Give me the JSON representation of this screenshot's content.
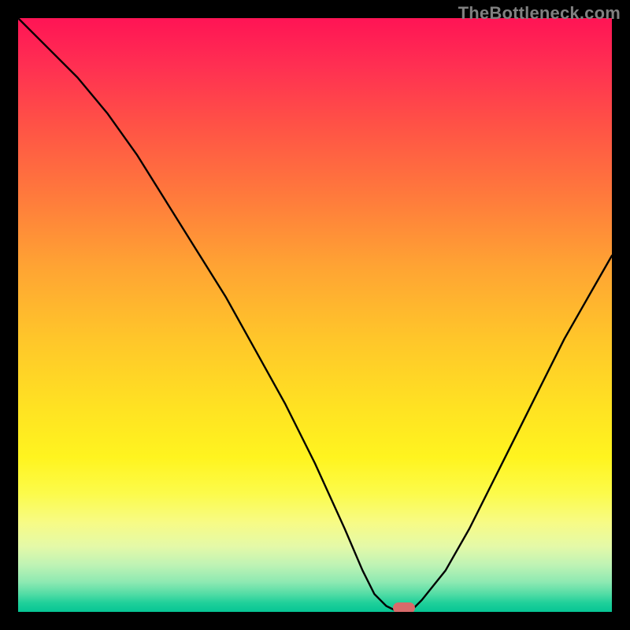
{
  "watermark": "TheBottleneck.com",
  "colors": {
    "frame_background": "#000000",
    "curve_stroke": "#000000",
    "marker_fill": "#d86a6a",
    "watermark_text": "#808080",
    "gradient_top": "#ff1455",
    "gradient_bottom": "#06c594"
  },
  "chart_data": {
    "type": "line",
    "title": "",
    "xlabel": "",
    "ylabel": "",
    "xlim": [
      0,
      100
    ],
    "ylim": [
      0,
      100
    ],
    "grid": false,
    "series": [
      {
        "name": "bottleneck-curve",
        "x": [
          0,
          5,
          10,
          15,
          20,
          25,
          30,
          35,
          40,
          45,
          50,
          55,
          58,
          60,
          62,
          64,
          66,
          68,
          72,
          76,
          80,
          84,
          88,
          92,
          96,
          100
        ],
        "values": [
          100,
          95,
          90,
          84,
          77,
          69,
          61,
          53,
          44,
          35,
          25,
          14,
          7,
          3,
          1,
          0,
          0,
          2,
          7,
          14,
          22,
          30,
          38,
          46,
          53,
          60
        ]
      }
    ],
    "annotations": [
      {
        "name": "optimal-marker",
        "x": 65,
        "y": 0.6,
        "shape": "pill",
        "color": "#d86a6a"
      }
    ],
    "background_style": "vertical-gradient red→yellow→green"
  }
}
